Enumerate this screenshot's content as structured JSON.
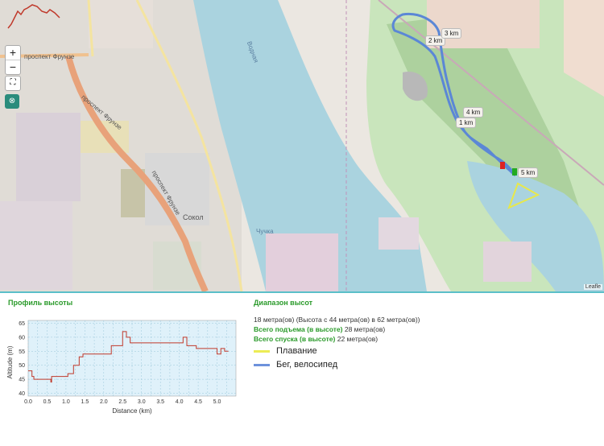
{
  "map": {
    "zoom_in": "+",
    "zoom_out": "−",
    "fullscreen_icon": "fullscreen-icon",
    "locate_icon": "locate-icon",
    "attribution": "Leafle",
    "place_labels": {
      "sokol": "Сокол",
      "frunze1": "проспект Фрунзе",
      "frunze2": "проспект Фрунзе",
      "frunze3": "проспект Фрунзе",
      "vodnaya": "Водная",
      "chuchka": "Чучка"
    },
    "km_markers": [
      "1 km",
      "2 km",
      "3 km",
      "4 km",
      "5 km"
    ],
    "colors": {
      "water": "#aad3df",
      "forest": "#add19e",
      "park": "#c8e6bb",
      "urban": "#e0dfdf",
      "industrial": "#ebdbe8",
      "road_main": "#e8a27a",
      "route_run": "#5b87d6",
      "route_swim": "#e8e84a"
    }
  },
  "profile": {
    "title": "Профиль высоты",
    "ylabel": "Altitude (m)",
    "xlabel": "Distance (km)"
  },
  "stats": {
    "title": "Диапазон высот",
    "range_line": "18 метра(ов) (Высота с 44 метра(ов) в 62 метра(ов))",
    "ascent_label": "Всего подъема (в высоте)",
    "ascent_value": " 28 метра(ов)",
    "descent_label": "Всего спуска (в высоте)",
    "descent_value": " 22 метра(ов)"
  },
  "legend": [
    {
      "label": "Плавание",
      "color": "#ecec55"
    },
    {
      "label": "Бег, велосипед",
      "color": "#6d92dc"
    }
  ],
  "chart_data": {
    "type": "line",
    "title": "",
    "xlabel": "Distance (km)",
    "ylabel": "Altitude (m)",
    "xlim": [
      0,
      5.5
    ],
    "ylim": [
      39,
      66
    ],
    "xticks": [
      0.0,
      0.25,
      0.5,
      0.75,
      1.0,
      1.25,
      1.5,
      1.75,
      2.0,
      2.25,
      2.5,
      2.75,
      3.0,
      3.25,
      3.5,
      3.75,
      4.0,
      4.25,
      4.5,
      4.75,
      5.0,
      5.25
    ],
    "xtick_labels": [
      "0.0",
      "0.5",
      "1.0",
      "1.5",
      "2.0",
      "2.5",
      "3.0",
      "3.5",
      "4.0",
      "4.5",
      "5.0"
    ],
    "yticks": [
      40,
      45,
      50,
      55,
      60,
      65
    ],
    "grid": true,
    "x": [
      0.0,
      0.05,
      0.1,
      0.15,
      0.2,
      0.3,
      0.45,
      0.55,
      0.6,
      0.62,
      0.68,
      0.72,
      0.8,
      0.9,
      1.05,
      1.15,
      1.2,
      1.28,
      1.35,
      1.45,
      1.55,
      1.65,
      1.75,
      1.85,
      1.95,
      2.1,
      2.2,
      2.3,
      2.4,
      2.45,
      2.5,
      2.55,
      2.6,
      2.7,
      2.9,
      3.1,
      3.3,
      3.5,
      3.7,
      3.9,
      4.05,
      4.1,
      4.15,
      4.2,
      4.25,
      4.35,
      4.45,
      4.55,
      4.7,
      4.85,
      4.95,
      5.0,
      5.05,
      5.1,
      5.15,
      5.2,
      5.3
    ],
    "y": [
      48,
      48,
      46,
      45,
      45,
      45,
      45,
      45,
      44,
      46,
      46,
      46,
      46,
      46,
      47,
      47,
      50,
      50,
      53,
      54,
      54,
      54,
      54,
      54,
      54,
      54,
      57,
      57,
      57,
      57,
      62,
      62,
      60,
      58,
      58,
      58,
      58,
      58,
      58,
      58,
      58,
      60,
      60,
      57,
      57,
      57,
      56,
      56,
      56,
      56,
      56,
      54,
      54,
      56,
      56,
      55,
      55
    ]
  }
}
